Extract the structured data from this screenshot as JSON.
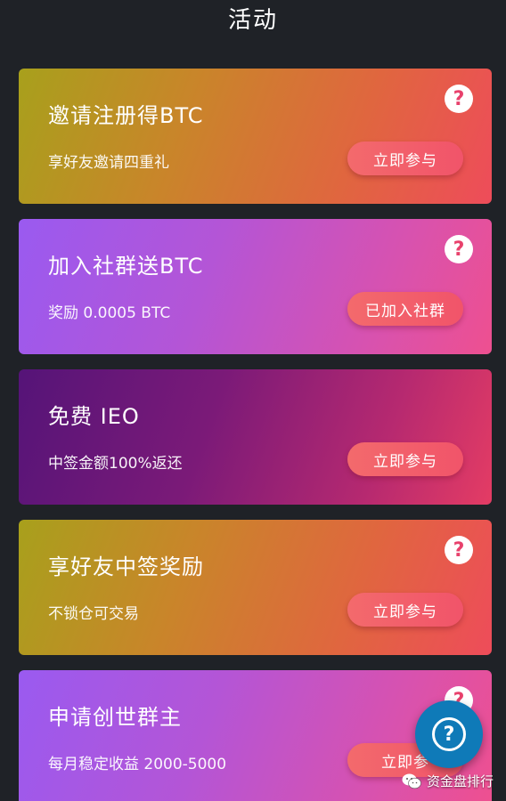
{
  "header": {
    "title": "活动"
  },
  "cards": [
    {
      "title": "邀请注册得BTC",
      "subtitle": "享好友邀请四重礼",
      "button": "立即参与",
      "help": "?"
    },
    {
      "title": "加入社群送BTC",
      "subtitle": "奖励 0.0005 BTC",
      "button": "已加入社群",
      "help": "?"
    },
    {
      "title": "免费 IEO",
      "subtitle": "中签金额100%返还",
      "button": "立即参与",
      "help": "?"
    },
    {
      "title": "享好友中签奖励",
      "subtitle": "不锁仓可交易",
      "button": "立即参与",
      "help": "?"
    },
    {
      "title": "申请创世群主",
      "subtitle": "每月稳定收益 2000-5000",
      "button": "立即参",
      "help": "?"
    }
  ],
  "fab": {
    "label": "?",
    "icon": "help-circle-icon"
  },
  "watermark": {
    "text": "资金盘排行",
    "icon": "wechat-icon"
  }
}
